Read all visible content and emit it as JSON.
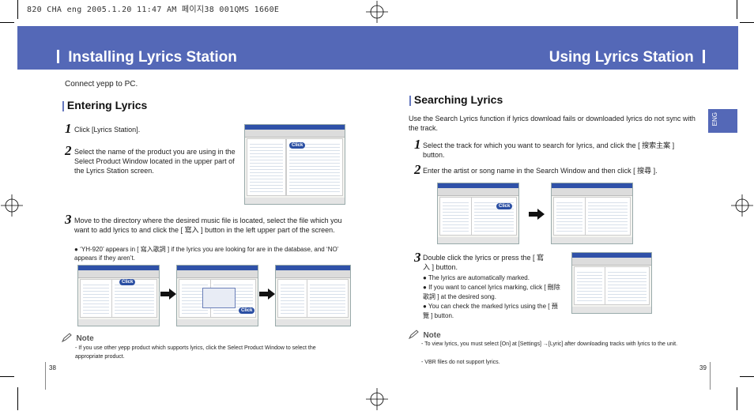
{
  "slug": "820 CHA eng  2005.1.20 11:47 AM 페이지38   001QMS 1660E",
  "left_page": {
    "title": "Installing Lyrics Station",
    "intro": "Connect yepp to PC.",
    "section_title": "Entering Lyrics",
    "steps": [
      {
        "num": "1",
        "text": "Click [Lyrics Station]."
      },
      {
        "num": "2",
        "text": "Select the name of the product you are using in the Select Product Window located in the upper part of the Lyrics Station screen."
      },
      {
        "num": "3",
        "text": "Move to the directory where the desired music file is located, select the file which you want to add lyrics to and click the [ 寫入 ] button in the left upper part of the screen."
      }
    ],
    "bullets": [
      "‘YH-920’ appears in [ 寫入歌詞 ] if the lyrics you are looking for are in the database, and ‘NO’ appears if they aren’t."
    ],
    "note_label": "Note",
    "notes": [
      "- If you use other yepp product which supports lyrics, click the Select Product Window to select the appropriate product."
    ],
    "page_number": "38"
  },
  "right_page": {
    "title": "Using Lyrics Station",
    "section_title": "Searching Lyrics",
    "intro": "Use the Search Lyrics function if lyrics download fails or downloaded lyrics do not sync with the track.",
    "steps": [
      {
        "num": "1",
        "text": "Select the track for which you want to search for lyrics, and click the [ 搜索主案 ] button."
      },
      {
        "num": "2",
        "text": "Enter the artist or song name in the Search Window and then click [ 搜尋 ]."
      },
      {
        "num": "3",
        "text": "Double click the lyrics or press the [ 寫入 ] button."
      }
    ],
    "bullets": [
      "The lyrics are automatically marked.",
      "If you want to cancel lyrics marking, click [ 刪除歌詞 ] at the desired song.",
      "You can check the marked lyrics using the [ 預覽 ] button."
    ],
    "note_label": "Note",
    "notes": [
      "- To view lyrics, you must select [On] at [Settings] →[Lyric] after downloading tracks with lyrics to the unit.",
      "- VBR files do not support lyrics."
    ],
    "page_number": "39",
    "tab_label": "ENG"
  },
  "screens": {
    "app_logo": "yepp",
    "click_label": "Click"
  },
  "colors": {
    "header": "#5468b7",
    "titlebar": "#2f51a8"
  }
}
